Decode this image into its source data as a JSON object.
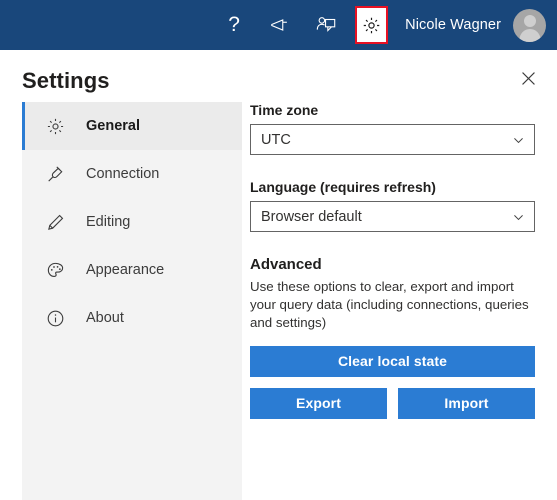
{
  "topbar": {
    "icons": [
      {
        "name": "help-icon",
        "glyph": "?"
      },
      {
        "name": "megaphone-icon",
        "glyph": ""
      },
      {
        "name": "feedback-icon",
        "glyph": ""
      },
      {
        "name": "gear-icon",
        "glyph": ""
      }
    ],
    "username": "Nicole Wagner",
    "avatar_alt": "user-avatar",
    "background_color": "#19477b",
    "highlight_color": "#e81123"
  },
  "panel": {
    "title": "Settings",
    "close_label": "✕"
  },
  "sidebar": {
    "items": [
      {
        "label": "General",
        "icon": "gear-icon",
        "selected": true
      },
      {
        "label": "Connection",
        "icon": "plug-icon",
        "selected": false
      },
      {
        "label": "Editing",
        "icon": "pencil-icon",
        "selected": false
      },
      {
        "label": "Appearance",
        "icon": "palette-icon",
        "selected": false
      },
      {
        "label": "About",
        "icon": "info-icon",
        "selected": false
      }
    ],
    "accent_color": "#2b7cd3",
    "background_color": "#f3f3f3"
  },
  "content": {
    "timezone": {
      "label": "Time zone",
      "value": "UTC"
    },
    "language": {
      "label": "Language (requires refresh)",
      "value": "Browser default"
    },
    "advanced": {
      "heading": "Advanced",
      "description": "Use these options to clear, export and import your query data (including connections, queries and settings)",
      "clear_button": "Clear local state",
      "export_button": "Export",
      "import_button": "Import",
      "button_color": "#2b7cd3"
    }
  }
}
